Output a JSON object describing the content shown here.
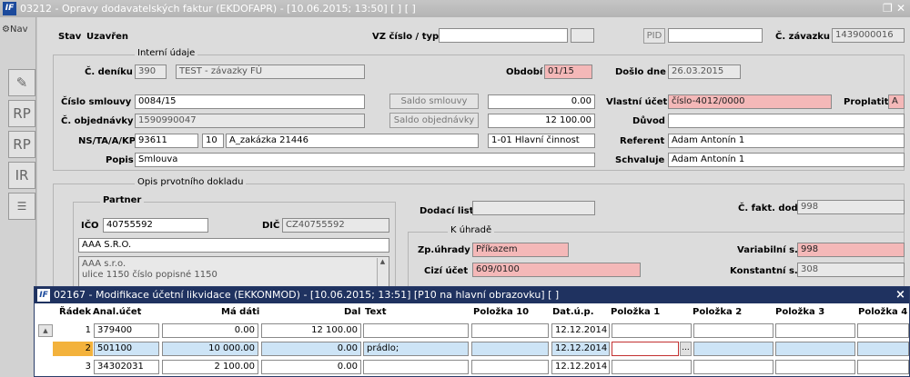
{
  "window": {
    "title": "03212 - Opravy dodavatelských faktur (EKDOFAPR) - [10.06.2015; 13:50]  [ ]  [ ]"
  },
  "nav": {
    "label": "Nav",
    "tools": [
      "RP",
      "RP",
      "IR"
    ]
  },
  "header": {
    "stav_label": "Stav",
    "stav_value": "Uzavřen",
    "vz_label": "VZ číslo / typ",
    "vz_value": "",
    "vz_type": "",
    "pid_label": "PID",
    "pid_value": "",
    "zavazek_label": "Č. závazku",
    "zavazek_value": "1439000016"
  },
  "interni": {
    "legend": "Interní údaje",
    "denik_label": "Č. deníku",
    "denik_code": "390",
    "denik_name": "TEST - závazky FÚ",
    "obdobi_label": "Období",
    "obdobi_value": "01/15",
    "doslo_label": "Došlo dne",
    "doslo_value": "26.03.2015",
    "smlouva_label": "Číslo smlouvy",
    "smlouva_value": "0084/15",
    "saldo_smlouvy_btn": "Saldo smlouvy",
    "saldo_smlouvy_value": "0.00",
    "vlastni_ucet_label": "Vlastní účet",
    "vlastni_ucet_value": "číslo-4012/0000",
    "proplatit_label": "Proplatit",
    "proplatit_value": "A",
    "objednavka_label": "Č. objednávky",
    "objednavka_value": "1590990047",
    "saldo_objednavky_btn": "Saldo objednávky",
    "saldo_objednavky_value": "12 100.00",
    "duvod_label": "Důvod",
    "duvod_value": "",
    "ns_label": "NS/TA/A/KP",
    "ns_value": "93611",
    "ta_value": "10",
    "a_value": "A_zakázka 21446",
    "kp_value": "1-01 Hlavní činnost",
    "referent_label": "Referent",
    "referent_value": "Adam Antonín 1",
    "popis_label": "Popis",
    "popis_value": "Smlouva",
    "schvaluje_label": "Schvaluje",
    "schvaluje_value": "Adam Antonín 1"
  },
  "doklad": {
    "legend": "Opis prvotního dokladu",
    "partner_legend": "Partner",
    "ico_label": "IČO",
    "ico_value": "40755592",
    "dic_label": "DIČ",
    "dic_value": "CZ40755592",
    "partner_name": "AAA S.R.O.",
    "address_line1": "AAA s.r.o.",
    "address_line2": "ulice 1150 číslo popisné 1150",
    "dodaci_label": "Dodací list",
    "dodaci_value": "",
    "fakt_label": "Č. fakt. dod.",
    "fakt_value": "998",
    "uhrada_legend": "K úhradě",
    "zp_label": "Zp.úhrady",
    "zp_value": "Příkazem",
    "variabilni_label": "Variabilní s.",
    "variabilni_value": "998",
    "cizi_label": "Cizí účet",
    "cizi_value": "609/0100",
    "konstantni_label": "Konstantní s.",
    "konstantni_value": "308"
  },
  "dialog": {
    "title": "02167 - Modifikace účetní likvidace (EKKONMOD) - [10.06.2015; 13:51]  [P10 na hlavní obrazovku]  [ ]",
    "close": "×",
    "columns": {
      "radek": "Řádek",
      "anal": "Anal.účet",
      "ma": "Má dáti",
      "dal": "Dal",
      "text": "Text",
      "pol10": "Položka 10",
      "datup": "Dat.ú.p.",
      "pol1": "Položka 1",
      "pol2": "Položka 2",
      "pol3": "Položka 3",
      "pol4": "Položka 4"
    },
    "rows": [
      {
        "radek": "1",
        "anal": "379400",
        "ma": "0.00",
        "dal": "12 100.00",
        "text": "",
        "datup": "12.12.2014"
      },
      {
        "radek": "2",
        "anal": "501100",
        "ma": "10 000.00",
        "dal": "0.00",
        "text": "prádlo;",
        "datup": "12.12.2014"
      },
      {
        "radek": "3",
        "anal": "34302031",
        "ma": "2 100.00",
        "dal": "0.00",
        "text": "",
        "datup": "12.12.2014"
      }
    ],
    "ellipsis": "..."
  }
}
